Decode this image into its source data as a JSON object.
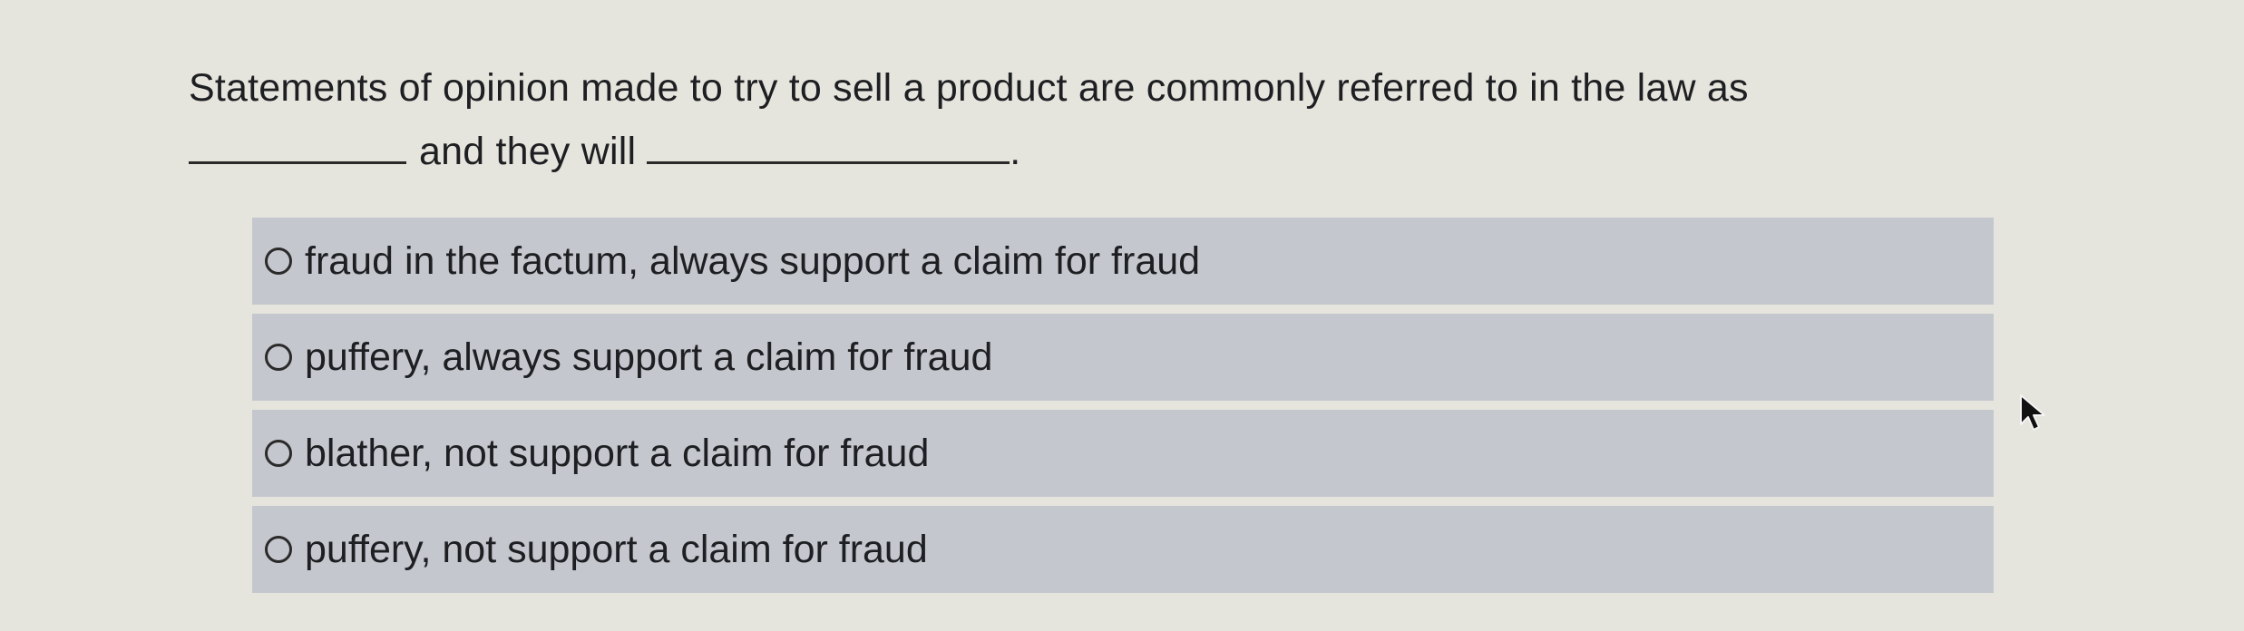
{
  "question": {
    "line1": "Statements of opinion made to try to sell a product are commonly referred to in the law as",
    "line2_middle": "and they will",
    "line2_end": "."
  },
  "options": [
    {
      "label": "fraud in the factum, always support a claim for fraud",
      "selected": false
    },
    {
      "label": "puffery, always support a claim for fraud",
      "selected": false
    },
    {
      "label": "blather, not support a claim for fraud",
      "selected": false
    },
    {
      "label": "puffery, not support a claim for fraud",
      "selected": false
    }
  ],
  "icons": {
    "radio": "radio-circle-icon",
    "cursor": "mouse-pointer-icon"
  }
}
